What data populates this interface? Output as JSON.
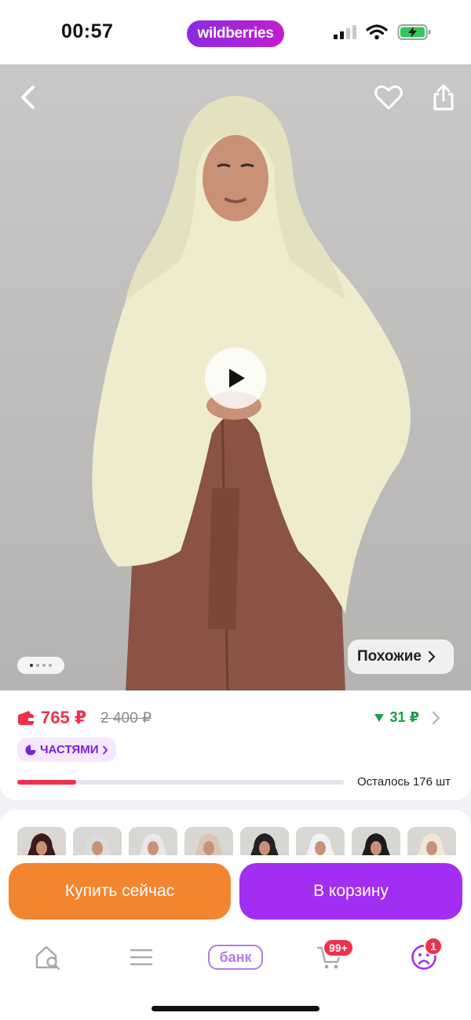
{
  "status_bar": {
    "time": "00:57",
    "brand": "wildberries",
    "icons": [
      "cellular-signal-icon",
      "wifi-icon",
      "battery-charging-icon"
    ]
  },
  "hero": {
    "icons": [
      "back-chevron-icon",
      "heart-icon",
      "share-icon",
      "play-icon"
    ],
    "similar_label": "Похожие",
    "image_count": 4,
    "current_image": 1
  },
  "price": {
    "current": "765 ₽",
    "old": "2 400 ₽",
    "bonus": "31 ₽",
    "installments_label": "ЧАСТЯМИ",
    "stock_text": "Осталось 176 шт",
    "stock_fraction": 0.18
  },
  "variants": {
    "count": 8,
    "colors": [
      "#3a1a1a",
      "#dcdcdc",
      "#e8e8e8",
      "#d8c7b8",
      "#222222",
      "#f2f2f2",
      "#1c1c1c",
      "#efe7da"
    ]
  },
  "actions": {
    "buy_now": "Купить сейчас",
    "add_to_cart": "В корзину"
  },
  "tabbar": {
    "bank_label": "банк",
    "cart_badge": "99+",
    "profile_badge": "1",
    "icons": [
      "home-search-icon",
      "catalog-menu-icon",
      "cart-icon",
      "profile-icon"
    ]
  },
  "colors": {
    "brand_purple": "#a12ef0",
    "buy_orange": "#f28530",
    "price_red": "#f0304d",
    "bonus_green": "#1aa04c"
  }
}
